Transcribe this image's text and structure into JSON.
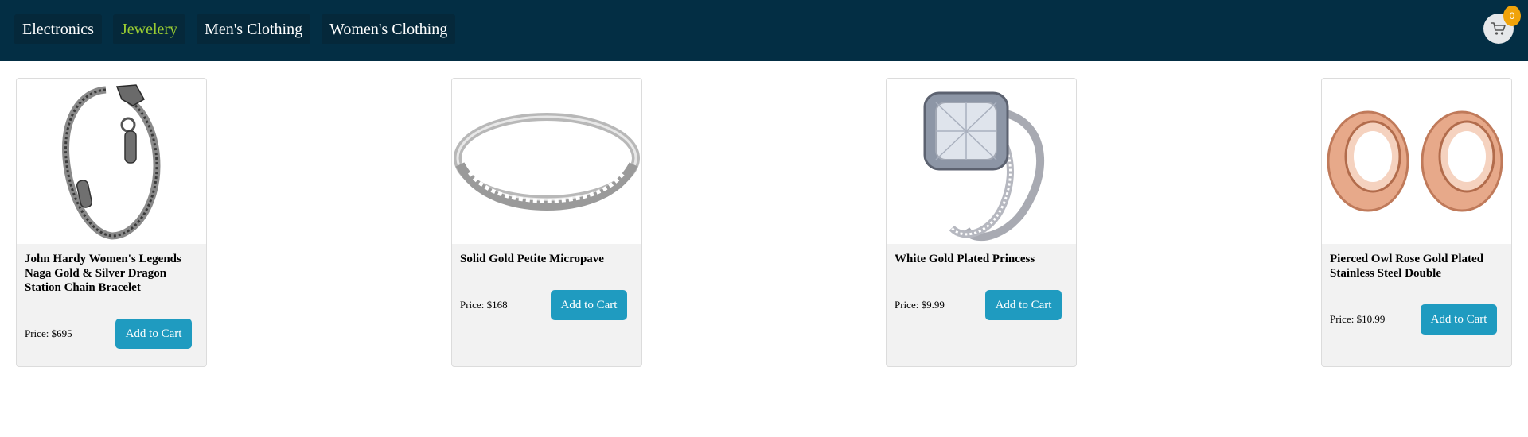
{
  "nav": {
    "items": [
      {
        "label": "Electronics",
        "active": false
      },
      {
        "label": "Jewelery",
        "active": true
      },
      {
        "label": "Men's Clothing",
        "active": false
      },
      {
        "label": "Women's Clothing",
        "active": false
      }
    ],
    "cart_count": "0",
    "cart_icon": "cart-icon",
    "accent_color": "#9acd32",
    "background_color": "#032e44"
  },
  "products": [
    {
      "title": "John Hardy Women's Legends Naga Gold & Silver Dragon Station Chain Bracelet",
      "price_label": "Price:",
      "price": "$695",
      "button_label": "Add to Cart",
      "image": "dragon-chain-bracelet"
    },
    {
      "title": "Solid Gold Petite Micropave",
      "price_label": "Price:",
      "price": "$168",
      "button_label": "Add to Cart",
      "image": "micropave-band-ring"
    },
    {
      "title": "White Gold Plated Princess",
      "price_label": "Price:",
      "price": "$9.99",
      "button_label": "Add to Cart",
      "image": "princess-cut-ring-set"
    },
    {
      "title": "Pierced Owl Rose Gold Plated Stainless Steel Double",
      "price_label": "Price:",
      "price": "$10.99",
      "button_label": "Add to Cart",
      "image": "rose-gold-tunnel-plugs"
    }
  ],
  "colors": {
    "button": "#1f9bc0",
    "badge": "#f0a30a",
    "card_background": "#f2f2f2"
  }
}
